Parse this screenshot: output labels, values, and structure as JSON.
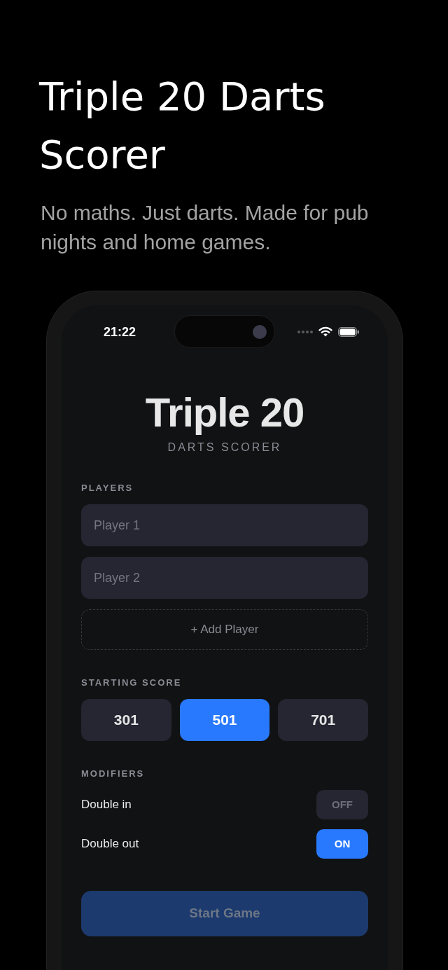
{
  "promo": {
    "headline": "Triple 20 Darts Scorer",
    "tagline": "No maths. Just darts. Made for pub nights and home games."
  },
  "status_bar": {
    "time": "21:22"
  },
  "app": {
    "title": "Triple 20",
    "subtitle": "DARTS SCORER",
    "players": {
      "label": "PLAYERS",
      "fields": [
        {
          "placeholder": "Player 1"
        },
        {
          "placeholder": "Player 2"
        }
      ],
      "add_button": "+ Add Player"
    },
    "starting_score": {
      "label": "STARTING SCORE",
      "options": [
        {
          "label": "301",
          "selected": false
        },
        {
          "label": "501",
          "selected": true
        },
        {
          "label": "701",
          "selected": false
        }
      ]
    },
    "modifiers": {
      "label": "MODIFIERS",
      "items": [
        {
          "label": "Double in",
          "on": false,
          "toggle_text": "OFF"
        },
        {
          "label": "Double out",
          "on": true,
          "toggle_text": "ON"
        }
      ]
    },
    "start_button": {
      "label": "Start Game",
      "disabled": true
    }
  }
}
